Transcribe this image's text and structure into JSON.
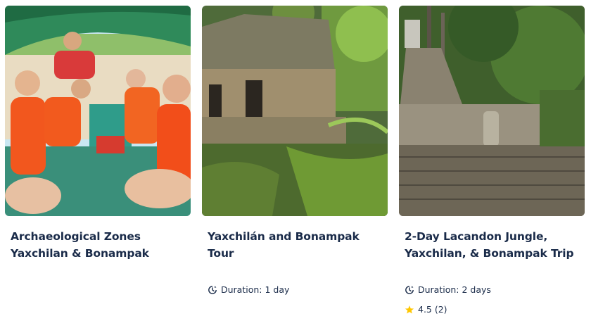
{
  "cards": [
    {
      "title_line1": "Archaeological Zones",
      "title_line2": "Yaxchilan & Bonampak",
      "photo_icon": "tourists-in-boat-photo"
    },
    {
      "title_line1": "Yaxchilán and Bonampak Tour",
      "title_line2": "",
      "duration": "Duration: 1 day",
      "photo_icon": "stone-ruins-in-jungle-photo"
    },
    {
      "title_line1": "2-Day Lacandon Jungle,",
      "title_line2": "Yaxchilan, & Bonampak Trip",
      "duration": "Duration: 2 days",
      "rating": "4.5 (2)",
      "photo_icon": "jungle-stone-staircase-photo"
    }
  ],
  "icons": {
    "duration": "clock-icon",
    "rating": "star-icon"
  },
  "colors": {
    "text": "#1a2b49",
    "star": "#ffc700"
  }
}
